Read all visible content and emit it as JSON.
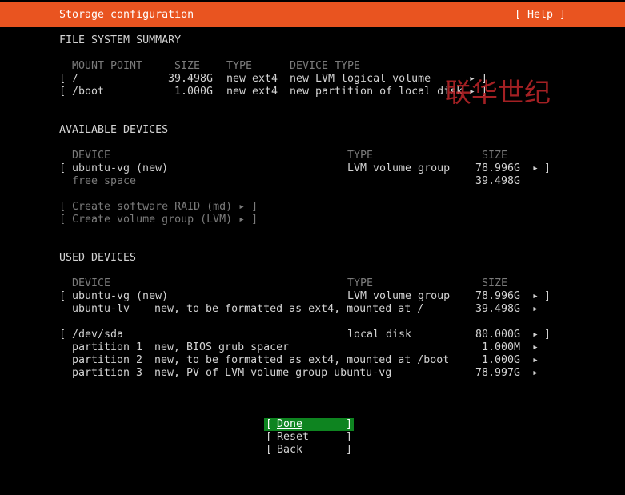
{
  "header": {
    "title": "Storage configuration",
    "help": "[ Help ]"
  },
  "fs_summary": {
    "title": "FILE SYSTEM SUMMARY",
    "columns": [
      "MOUNT POINT",
      "SIZE",
      "TYPE",
      "DEVICE TYPE"
    ],
    "rows": [
      {
        "mount": "/",
        "size": "39.498G",
        "type": "new ext4",
        "devtype": "new LVM logical volume"
      },
      {
        "mount": "/boot",
        "size": "1.000G",
        "type": "new ext4",
        "devtype": "new partition of local disk"
      }
    ]
  },
  "available": {
    "title": "AVAILABLE DEVICES",
    "columns": [
      "DEVICE",
      "TYPE",
      "SIZE"
    ],
    "vg": {
      "name": "ubuntu-vg (new)",
      "type": "LVM volume group",
      "size": "78.996G"
    },
    "free": {
      "name": "free space",
      "size": "39.498G"
    },
    "actions": [
      "[ Create software RAID (md) ▸ ]",
      "[ Create volume group (LVM) ▸ ]"
    ]
  },
  "used": {
    "title": "USED DEVICES",
    "columns": [
      "DEVICE",
      "TYPE",
      "SIZE"
    ],
    "vg": {
      "name": "ubuntu-vg (new)",
      "type": "LVM volume group",
      "size": "78.996G"
    },
    "lv": {
      "name": "ubuntu-lv",
      "desc": "new, to be formatted as ext4, mounted at /",
      "size": "39.498G"
    },
    "disk": {
      "name": "/dev/sda",
      "type": "local disk",
      "size": "80.000G"
    },
    "partitions": [
      {
        "name": "partition 1",
        "desc": "new, BIOS grub spacer",
        "size": "1.000M"
      },
      {
        "name": "partition 2",
        "desc": "new, to be formatted as ext4, mounted at /boot",
        "size": "1.000G"
      },
      {
        "name": "partition 3",
        "desc": "new, PV of LVM volume group ubuntu-vg",
        "size": "78.997G"
      }
    ]
  },
  "buttons": {
    "done": "Done",
    "reset": "Reset",
    "back": "Back"
  },
  "watermark": "联华世纪",
  "glyphs": {
    "lbr": "[",
    "rbr": "]",
    "arrow": "▸"
  }
}
